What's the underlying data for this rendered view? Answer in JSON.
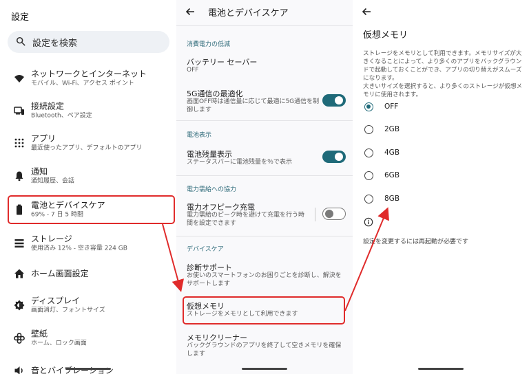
{
  "panel1": {
    "title": "設定",
    "search_label": "設定を検索",
    "items": [
      {
        "icon": "wifi-icon",
        "title": "ネットワークとインターネット",
        "sub": "モバイル、Wi-Fi、アクセス ポイント"
      },
      {
        "icon": "devices-icon",
        "title": "接続設定",
        "sub": "Bluetooth、ペア設定"
      },
      {
        "icon": "apps-grid-icon",
        "title": "アプリ",
        "sub": "最近使ったアプリ、デフォルトのアプリ"
      },
      {
        "icon": "bell-icon",
        "title": "通知",
        "sub": "通知履歴、会話"
      },
      {
        "icon": "battery-icon",
        "title": "電池とデバイスケア",
        "sub": "69% - 7 日 5 時間"
      },
      {
        "icon": "storage-icon",
        "title": "ストレージ",
        "sub": "使用済み 12% - 空き容量 224 GB"
      },
      {
        "icon": "home-icon",
        "title": "ホーム画面設定",
        "sub": ""
      },
      {
        "icon": "brightness-icon",
        "title": "ディスプレイ",
        "sub": "画面消灯、フォントサイズ"
      },
      {
        "icon": "wallpaper-icon",
        "title": "壁紙",
        "sub": "ホーム、ロック画面"
      },
      {
        "icon": "volume-icon",
        "title": "音とバイブレーション",
        "sub": ""
      }
    ]
  },
  "panel2": {
    "title": "電池とデバイスケア",
    "sections": {
      "power_saving": "消費電力の低減",
      "battery_display": "電池表示",
      "power_cooperation": "電力需給への協力",
      "device_care": "デバイスケア"
    },
    "rows": {
      "battery_saver": {
        "title": "バッテリー セーバー",
        "sub": "OFF"
      },
      "optimize_5g": {
        "title": "5G通信の最適化",
        "sub": "画面OFF時は通信量に応じて最適に5G通信を制御します",
        "on": true
      },
      "battery_percent": {
        "title": "電池残量表示",
        "sub": "ステータスバーに電池残量を％で表示",
        "on": true
      },
      "off_peak": {
        "title": "電力オフピーク充電",
        "sub": "電力需給のピーク時を避けて充電を行う時間を設定できます",
        "on": false
      },
      "diagnosis": {
        "title": "診断サポート",
        "sub": "お使いのスマートフォンのお困りごとを診断し、解決をサポートします"
      },
      "virtual_memory": {
        "title": "仮想メモリ",
        "sub": "ストレージをメモリとして利用できます"
      },
      "memory_cleaner": {
        "title": "メモリクリーナー",
        "sub": "バックグラウンドのアプリを終了して空きメモリを確保します"
      }
    }
  },
  "panel3": {
    "title": "仮想メモリ",
    "description": "ストレージをメモリとして利用できます。メモリサイズが大きくなることによって、より多くのアプリをバックグラウンドで起動しておくことができ、アプリの切り替えがスムーズになります。\n大きいサイズを選択すると、より多くのストレージが仮想メモリに使用されます。",
    "options": [
      "OFF",
      "2GB",
      "4GB",
      "6GB",
      "8GB"
    ],
    "selected_index": 0,
    "note": "設定を変更するには再起動が必要です"
  },
  "colors": {
    "accent": "#1f6a79",
    "highlight": "#e02b2b"
  }
}
